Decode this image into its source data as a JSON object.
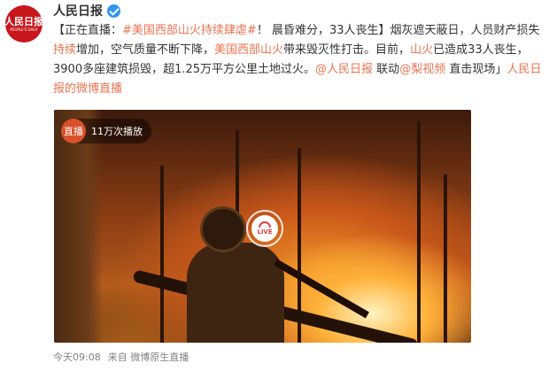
{
  "account": {
    "logo_text": "人民日报",
    "logo_subtext": "PEOPLE'S DAILY",
    "name": "人民日报",
    "verified_icon": "verified-badge-icon",
    "accent": "#eb7350"
  },
  "post": {
    "segments": [
      {
        "text": "【正在直播：",
        "link": false
      },
      {
        "text": "#美国西部山火持续肆虐#",
        "link": true
      },
      {
        "text": "！ 晨昏难分，33人丧生】烟灰遮天蔽日，人员财产损失",
        "link": false
      },
      {
        "text": "持续",
        "link": true
      },
      {
        "text": "增加，空气质量不断下降，",
        "link": false
      },
      {
        "text": "美国西部山火",
        "link": true
      },
      {
        "text": "带来毁灭性打击。目前，",
        "link": false
      },
      {
        "text": "山火",
        "link": true
      },
      {
        "text": "已造成33人丧生，3900多座建筑损毁，超1.25万平方公里土地过火。",
        "link": false
      },
      {
        "text": "@人民日报",
        "link": true
      },
      {
        "text": " 联动",
        "link": false
      },
      {
        "text": "@梨视频",
        "link": true
      },
      {
        "text": " 直击现场」",
        "link": false
      },
      {
        "text": "人民日报的微博直播",
        "link": true
      }
    ]
  },
  "media": {
    "live_tag": "直播",
    "view_count": "11万次播放",
    "live_badge_text": "LIVE",
    "live_badge_icon": "live-camera-icon"
  },
  "footer": {
    "time": "今天09:08",
    "source": "来自 微博原生直播"
  }
}
